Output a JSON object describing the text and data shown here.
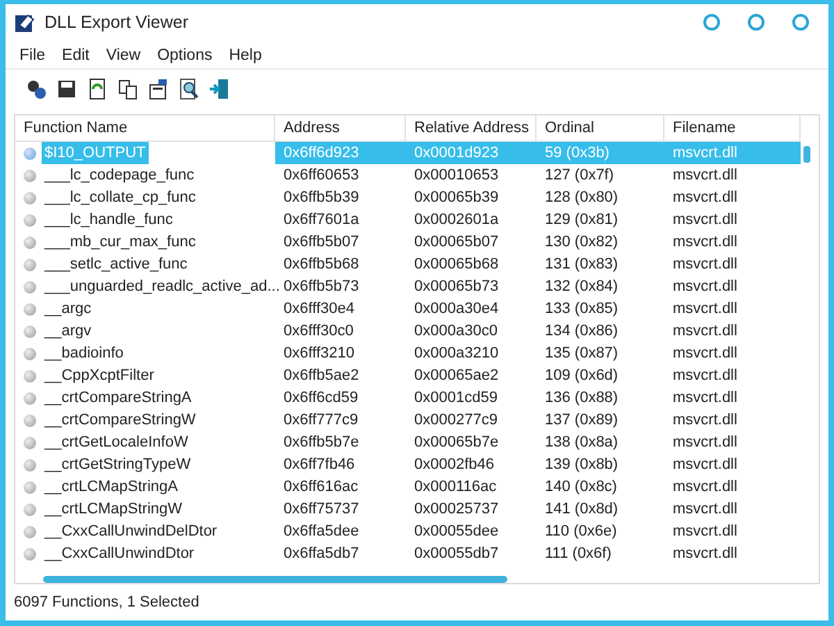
{
  "window": {
    "title": "DLL Export Viewer"
  },
  "menu": [
    "File",
    "Edit",
    "View",
    "Options",
    "Help"
  ],
  "table": {
    "columns": [
      "Function Name",
      "Address",
      "Relative Address",
      "Ordinal",
      "Filename"
    ],
    "rows": [
      {
        "cells": [
          "$I10_OUTPUT",
          "0x6ff6d923",
          "0x0001d923",
          "59 (0x3b)",
          "msvcrt.dll"
        ],
        "selected": true
      },
      {
        "cells": [
          "___lc_codepage_func",
          "0x6ff60653",
          "0x00010653",
          "127 (0x7f)",
          "msvcrt.dll"
        ],
        "selected": false
      },
      {
        "cells": [
          "___lc_collate_cp_func",
          "0x6ffb5b39",
          "0x00065b39",
          "128 (0x80)",
          "msvcrt.dll"
        ],
        "selected": false
      },
      {
        "cells": [
          "___lc_handle_func",
          "0x6ff7601a",
          "0x0002601a",
          "129 (0x81)",
          "msvcrt.dll"
        ],
        "selected": false
      },
      {
        "cells": [
          "___mb_cur_max_func",
          "0x6ffb5b07",
          "0x00065b07",
          "130 (0x82)",
          "msvcrt.dll"
        ],
        "selected": false
      },
      {
        "cells": [
          "___setlc_active_func",
          "0x6ffb5b68",
          "0x00065b68",
          "131 (0x83)",
          "msvcrt.dll"
        ],
        "selected": false
      },
      {
        "cells": [
          "___unguarded_readlc_active_ad...",
          "0x6ffb5b73",
          "0x00065b73",
          "132 (0x84)",
          "msvcrt.dll"
        ],
        "selected": false
      },
      {
        "cells": [
          "__argc",
          "0x6fff30e4",
          "0x000a30e4",
          "133 (0x85)",
          "msvcrt.dll"
        ],
        "selected": false
      },
      {
        "cells": [
          "__argv",
          "0x6fff30c0",
          "0x000a30c0",
          "134 (0x86)",
          "msvcrt.dll"
        ],
        "selected": false
      },
      {
        "cells": [
          "__badioinfo",
          "0x6fff3210",
          "0x000a3210",
          "135 (0x87)",
          "msvcrt.dll"
        ],
        "selected": false
      },
      {
        "cells": [
          "__CppXcptFilter",
          "0x6ffb5ae2",
          "0x00065ae2",
          "109 (0x6d)",
          "msvcrt.dll"
        ],
        "selected": false
      },
      {
        "cells": [
          "__crtCompareStringA",
          "0x6ff6cd59",
          "0x0001cd59",
          "136 (0x88)",
          "msvcrt.dll"
        ],
        "selected": false
      },
      {
        "cells": [
          "__crtCompareStringW",
          "0x6ff777c9",
          "0x000277c9",
          "137 (0x89)",
          "msvcrt.dll"
        ],
        "selected": false
      },
      {
        "cells": [
          "__crtGetLocaleInfoW",
          "0x6ffb5b7e",
          "0x00065b7e",
          "138 (0x8a)",
          "msvcrt.dll"
        ],
        "selected": false
      },
      {
        "cells": [
          "__crtGetStringTypeW",
          "0x6ff7fb46",
          "0x0002fb46",
          "139 (0x8b)",
          "msvcrt.dll"
        ],
        "selected": false
      },
      {
        "cells": [
          "__crtLCMapStringA",
          "0x6ff616ac",
          "0x000116ac",
          "140 (0x8c)",
          "msvcrt.dll"
        ],
        "selected": false
      },
      {
        "cells": [
          "__crtLCMapStringW",
          "0x6ff75737",
          "0x00025737",
          "141 (0x8d)",
          "msvcrt.dll"
        ],
        "selected": false
      },
      {
        "cells": [
          "__CxxCallUnwindDelDtor",
          "0x6ffa5dee",
          "0x00055dee",
          "110 (0x6e)",
          "msvcrt.dll"
        ],
        "selected": false
      },
      {
        "cells": [
          "__CxxCallUnwindDtor",
          "0x6ffa5db7",
          "0x00055db7",
          "111 (0x6f)",
          "msvcrt.dll"
        ],
        "selected": false
      }
    ]
  },
  "status_bar": "6097 Functions, 1 Selected"
}
